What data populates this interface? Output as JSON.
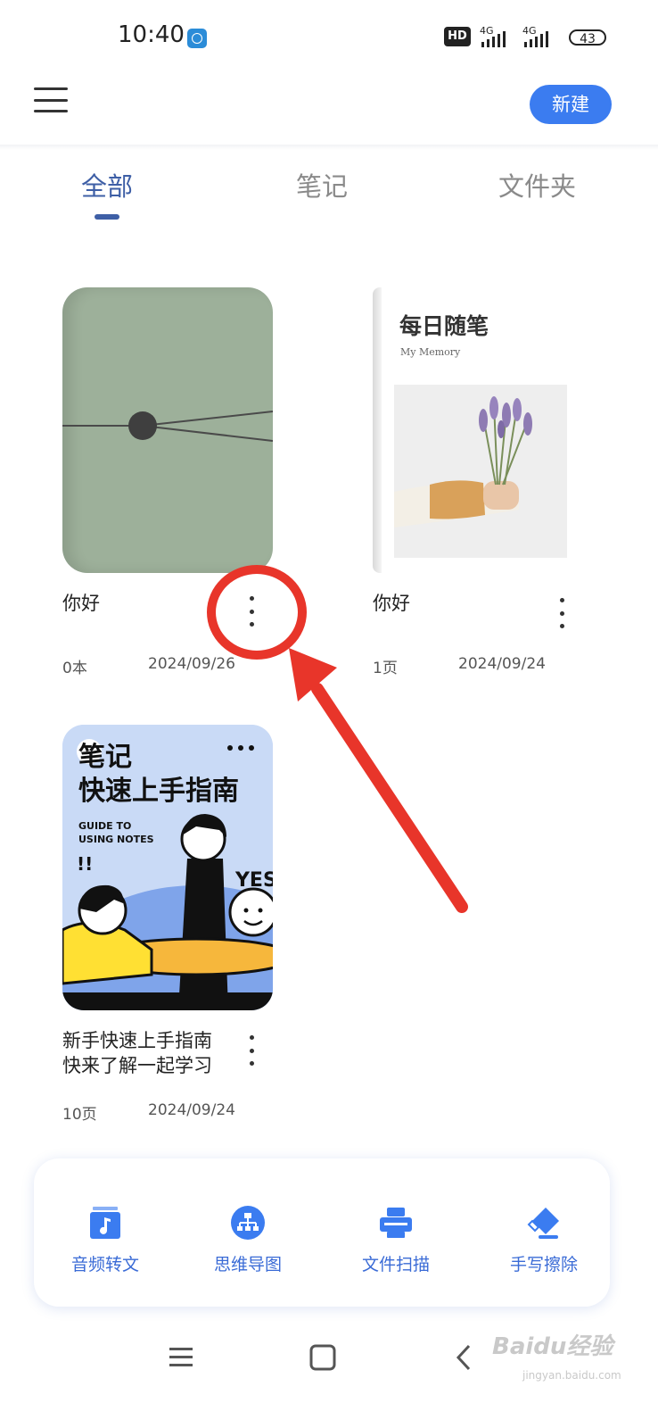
{
  "status_bar": {
    "time": "10:40",
    "hd_label": "HD",
    "network_1": "4G",
    "network_2": "4G",
    "battery": "43"
  },
  "header": {
    "menu_icon": "hamburger-menu-icon",
    "new_button": "新建"
  },
  "tabs": [
    {
      "label": "全部",
      "active": true
    },
    {
      "label": "笔记",
      "active": false
    },
    {
      "label": "文件夹",
      "active": false
    }
  ],
  "cards": [
    {
      "title": "你好",
      "count": "0本",
      "date": "2024/09/26"
    },
    {
      "title": "你好",
      "count": "1页",
      "date": "2024/09/24",
      "cover_title": "每日随笔",
      "cover_subtitle": "My Memory"
    },
    {
      "title_line1": "新手快速上手指南",
      "title_line2": "快来了解一起学习",
      "count": "10页",
      "date": "2024/09/24",
      "cover_title_line1": "笔记",
      "cover_title_line2": "快速上手指南",
      "cover_en_line1": "GUIDE TO",
      "cover_en_line2": "USING NOTES",
      "cover_exclaim": "!!",
      "cover_yes": "YES"
    }
  ],
  "toolbar": [
    {
      "label": "音频转文",
      "icon": "audio-note-icon"
    },
    {
      "label": "思维导图",
      "icon": "mind-map-icon"
    },
    {
      "label": "文件扫描",
      "icon": "scanner-icon"
    },
    {
      "label": "手写擦除",
      "icon": "eraser-icon"
    }
  ],
  "nav_bar": {
    "icons": [
      "recents-icon",
      "home-icon",
      "back-icon"
    ]
  },
  "watermark": {
    "text": "Baidu经验",
    "sub": "jingyan.baidu.com"
  },
  "colors": {
    "accent": "#3b7cf0",
    "tab_active": "#3e5fa6",
    "annotation": "#e8352a"
  }
}
